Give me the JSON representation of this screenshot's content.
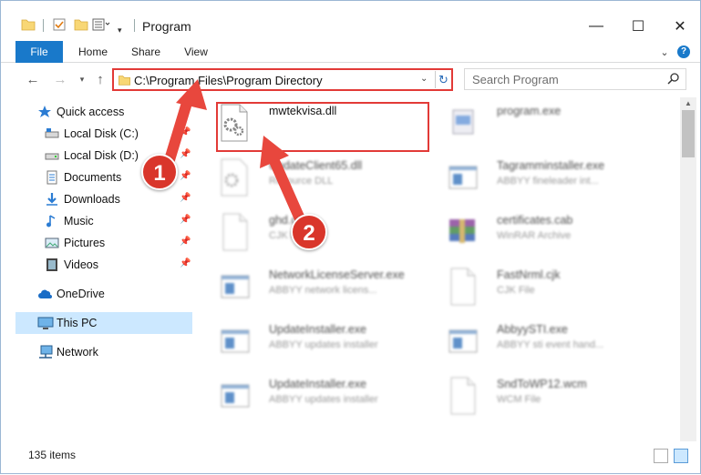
{
  "window": {
    "title": "Program",
    "controls": {
      "minimize": "—",
      "maximize": "☐",
      "close": "✕"
    }
  },
  "ribbon": {
    "tabs": [
      {
        "label": "File"
      },
      {
        "label": "Home"
      },
      {
        "label": "Share"
      },
      {
        "label": "View"
      }
    ],
    "help_label": "?"
  },
  "nav": {
    "address": "C:\\Program Files\\Program Directory",
    "search_placeholder": "Search Program"
  },
  "sidebar": {
    "items": [
      {
        "label": "Quick access",
        "icon": "star-icon"
      },
      {
        "label": "Local Disk (C:)",
        "icon": "drive-icon",
        "pinned": true
      },
      {
        "label": "Local Disk (D:)",
        "icon": "drive-icon",
        "pinned": true
      },
      {
        "label": "Documents",
        "icon": "documents-icon",
        "pinned": true
      },
      {
        "label": "Downloads",
        "icon": "download-icon",
        "pinned": true
      },
      {
        "label": "Music",
        "icon": "music-icon",
        "pinned": true
      },
      {
        "label": "Pictures",
        "icon": "pictures-icon",
        "pinned": true
      },
      {
        "label": "Videos",
        "icon": "videos-icon",
        "pinned": true
      },
      {
        "label": "OneDrive",
        "icon": "cloud-icon"
      },
      {
        "label": "This PC",
        "icon": "computer-icon",
        "selected": true
      },
      {
        "label": "Network",
        "icon": "network-icon"
      }
    ]
  },
  "files": [
    {
      "name": "mwtekvisa.dll",
      "desc": "",
      "icon": "dll-icon",
      "highlighted": true
    },
    {
      "name": "program.exe",
      "desc": "",
      "icon": "exe-icon"
    },
    {
      "name": "UpdateClient65.dll",
      "desc": "Resource DLL",
      "icon": "dll-icon"
    },
    {
      "name": "Tagramminstaller.exe",
      "desc": "ABBYY fineleader int...",
      "icon": "app-icon"
    },
    {
      "name": "ghd.cjk",
      "desc": "CJK File",
      "icon": "file-icon"
    },
    {
      "name": "certificates.cab",
      "desc": "WinRAR Archive",
      "icon": "archive-icon"
    },
    {
      "name": "NetworkLicenseServer.exe",
      "desc": "ABBYY network licens...",
      "icon": "app-icon"
    },
    {
      "name": "FastNrml.cjk",
      "desc": "CJK File",
      "icon": "file-icon"
    },
    {
      "name": "UpdateInstaller.exe",
      "desc": "ABBYY updates installer",
      "icon": "app-icon"
    },
    {
      "name": "AbbyySTI.exe",
      "desc": "ABBYY sti event hand...",
      "icon": "app-icon"
    },
    {
      "name": "UpdateInstaller.exe",
      "desc": "ABBYY updates installer",
      "icon": "app-icon"
    },
    {
      "name": "SndToWP12.wcm",
      "desc": "WCM File",
      "icon": "file-icon"
    }
  ],
  "status": {
    "item_count": "135 items"
  },
  "annotations": {
    "step1": "1",
    "step2": "2",
    "color": "#d9362b"
  }
}
